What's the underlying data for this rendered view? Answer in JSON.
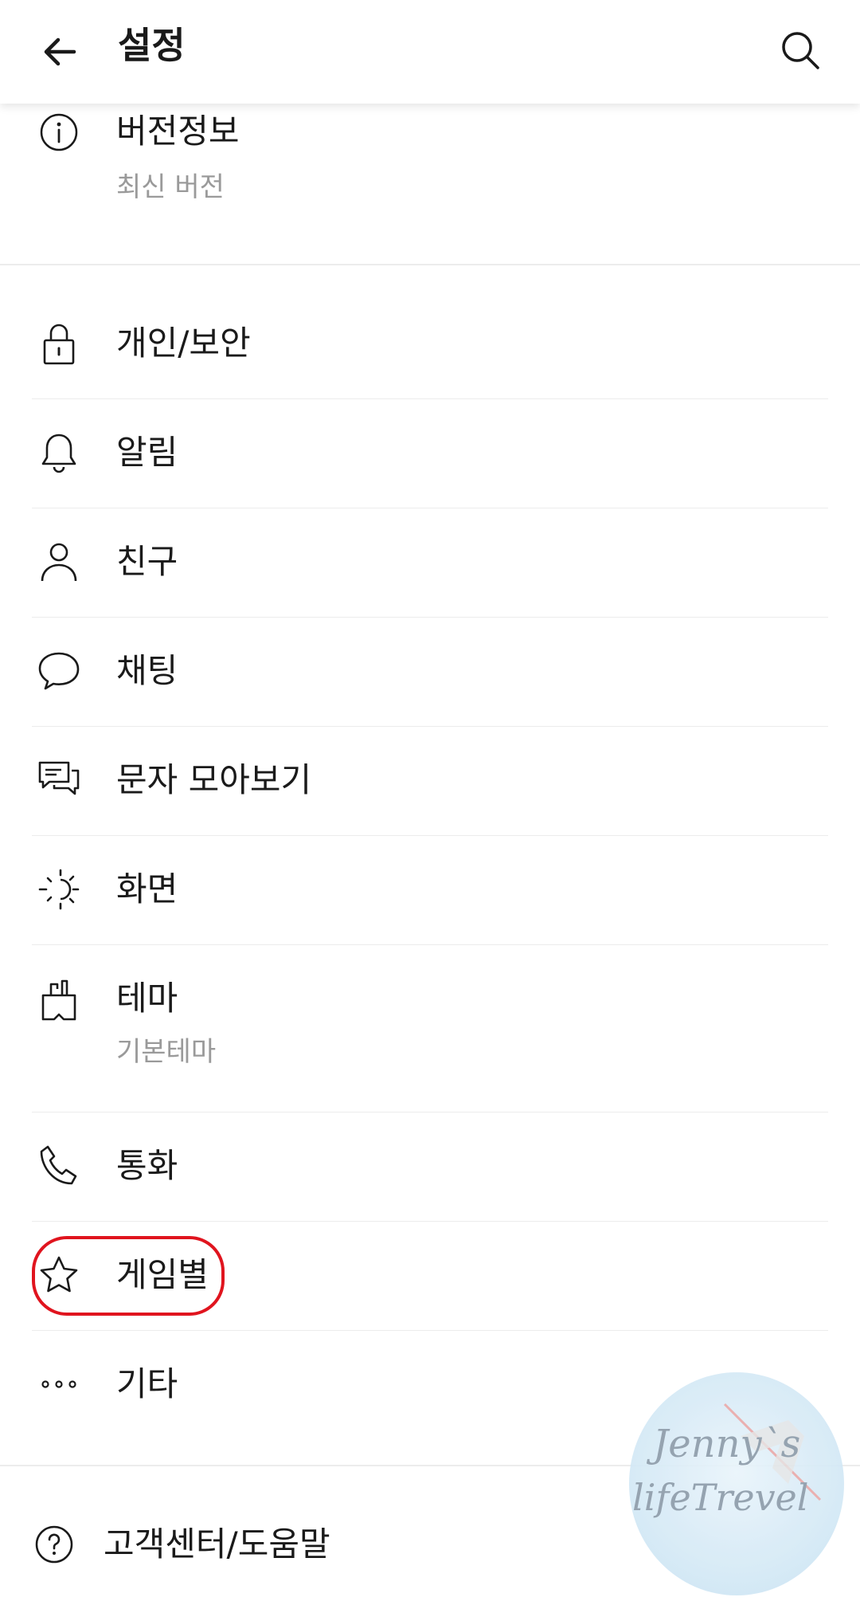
{
  "header": {
    "title": "설정",
    "back_icon": "arrow-left-icon",
    "search_icon": "search-icon"
  },
  "version": {
    "label": "버전정보",
    "sub": "최신 버전",
    "icon": "info-icon"
  },
  "menu": [
    {
      "label": "개인/보안",
      "icon": "lock-icon"
    },
    {
      "label": "알림",
      "icon": "bell-icon"
    },
    {
      "label": "친구",
      "icon": "person-icon"
    },
    {
      "label": "채팅",
      "icon": "chat-bubble-icon"
    },
    {
      "label": "문자 모아보기",
      "icon": "messages-icon"
    },
    {
      "label": "화면",
      "icon": "brightness-icon"
    },
    {
      "label": "테마",
      "sub": "기본테마",
      "icon": "brush-icon"
    },
    {
      "label": "통화",
      "icon": "phone-icon"
    },
    {
      "label": "게임별",
      "icon": "star-icon"
    },
    {
      "label": "기타",
      "icon": "more-icon"
    }
  ],
  "help": {
    "label": "고객센터/도움말",
    "icon": "question-icon"
  },
  "watermark": {
    "line1": "Jenny`s",
    "line2": "lifeTrevel"
  },
  "colors": {
    "highlight": "#e0141e",
    "subtext": "#9a9a9a",
    "divider": "#ececec"
  }
}
